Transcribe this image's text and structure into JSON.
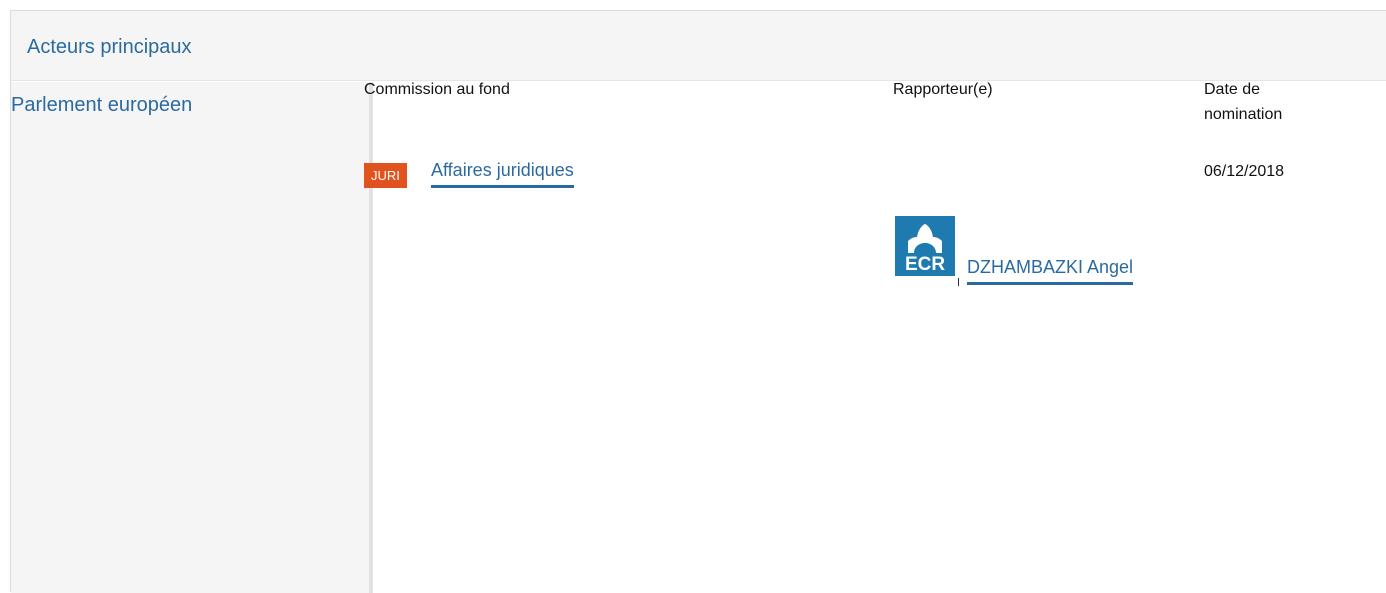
{
  "section": {
    "title": "Acteurs principaux"
  },
  "institution": {
    "name": "Parlement européen"
  },
  "columns": {
    "commission": "Commission au fond",
    "rapporteur": "Rapporteur(e)",
    "date": "Date de nomination"
  },
  "row": {
    "committee_code": "JURI",
    "committee_name": "Affaires juridiques",
    "nomination_date": "06/12/2018",
    "group_logo_text": "ECR",
    "rapporteur_name": "DZHAMBAZKI Angel"
  },
  "colors": {
    "link": "#2b6aa0",
    "badge": "#e0531f",
    "group_logo": "#1f7ab0",
    "panel": "#f5f5f5"
  },
  "icons": {
    "group_logo": "ecr-group-logo"
  }
}
